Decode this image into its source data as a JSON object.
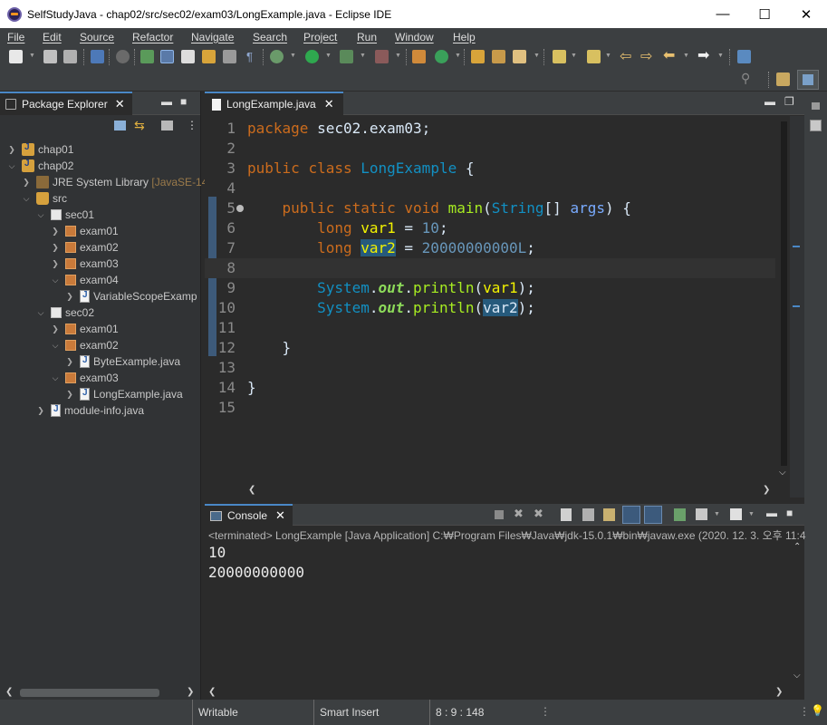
{
  "window": {
    "title": "SelfStudyJava - chap02/src/sec02/exam03/LongExample.java - Eclipse IDE",
    "minimize_glyph": "—",
    "maximize_glyph": "☐",
    "close_glyph": "✕"
  },
  "menu": [
    "File",
    "Edit",
    "Source",
    "Refactor",
    "Navigate",
    "Search",
    "Project",
    "Run",
    "Window",
    "Help"
  ],
  "package_explorer": {
    "tab_label": "Package Explorer",
    "tree": [
      {
        "label": "chap01",
        "icon": "project-icon",
        "expanded": false
      },
      {
        "label": "chap02",
        "icon": "project-icon",
        "expanded": true
      },
      {
        "label": "JRE System Library",
        "suffix": "[JavaSE-14",
        "icon": "library-icon",
        "expanded": false
      },
      {
        "label": "src",
        "icon": "source-folder-icon",
        "expanded": true
      },
      {
        "label": "sec01",
        "icon": "package-icon",
        "expanded": true
      },
      {
        "label": "exam01",
        "icon": "package-icon",
        "expanded": false
      },
      {
        "label": "exam02",
        "icon": "package-icon",
        "expanded": false
      },
      {
        "label": "exam03",
        "icon": "package-icon",
        "expanded": false
      },
      {
        "label": "exam04",
        "icon": "package-icon",
        "expanded": true
      },
      {
        "label": "VariableScopeExamp",
        "icon": "java-file-icon",
        "expanded": false
      },
      {
        "label": "sec02",
        "icon": "package-icon",
        "expanded": true
      },
      {
        "label": "exam01",
        "icon": "package-icon",
        "expanded": false
      },
      {
        "label": "exam02",
        "icon": "package-icon",
        "expanded": true
      },
      {
        "label": "ByteExample.java",
        "icon": "java-file-icon",
        "expanded": false
      },
      {
        "label": "exam03",
        "icon": "package-icon",
        "expanded": true
      },
      {
        "label": "LongExample.java",
        "icon": "java-file-icon",
        "expanded": false
      },
      {
        "label": "module-info.java",
        "icon": "java-file-icon",
        "expanded": false
      }
    ]
  },
  "editor": {
    "tab_label": "LongExample.java",
    "current_line": 8,
    "lines": [
      {
        "n": "1",
        "tokens": [
          [
            "kw",
            "package"
          ],
          [
            "p",
            " sec02.exam03;"
          ]
        ]
      },
      {
        "n": "2",
        "tokens": []
      },
      {
        "n": "3",
        "tokens": [
          [
            "kw",
            "public"
          ],
          [
            "p",
            " "
          ],
          [
            "kw",
            "class"
          ],
          [
            "p",
            " "
          ],
          [
            "tp",
            "LongExample"
          ],
          [
            "p",
            " {"
          ]
        ]
      },
      {
        "n": "4",
        "tokens": []
      },
      {
        "n": "5",
        "tokens": [
          [
            "p",
            "    "
          ],
          [
            "kw",
            "public"
          ],
          [
            "p",
            " "
          ],
          [
            "kw",
            "static"
          ],
          [
            "p",
            " "
          ],
          [
            "kw",
            "void"
          ],
          [
            "p",
            " "
          ],
          [
            "mt",
            "main"
          ],
          [
            "p",
            "("
          ],
          [
            "tp",
            "String"
          ],
          [
            "p",
            "[] "
          ],
          [
            "vr",
            "args"
          ],
          [
            "p",
            ") {"
          ]
        ]
      },
      {
        "n": "6",
        "tokens": [
          [
            "p",
            "        "
          ],
          [
            "kw",
            "long"
          ],
          [
            "p",
            " "
          ],
          [
            "lv",
            "var1"
          ],
          [
            "p",
            " = "
          ],
          [
            "nm",
            "10"
          ],
          [
            "p",
            ";"
          ]
        ]
      },
      {
        "n": "7",
        "tokens": [
          [
            "p",
            "        "
          ],
          [
            "kw",
            "long"
          ],
          [
            "p",
            " "
          ],
          [
            "hly",
            "var2"
          ],
          [
            "p",
            " = "
          ],
          [
            "nm",
            "20000000000L"
          ],
          [
            "p",
            ";"
          ]
        ]
      },
      {
        "n": "8",
        "tokens": []
      },
      {
        "n": "9",
        "tokens": [
          [
            "p",
            "        "
          ],
          [
            "tp",
            "System"
          ],
          [
            "p",
            "."
          ],
          [
            "fd",
            "out"
          ],
          [
            "p",
            "."
          ],
          [
            "mt",
            "println"
          ],
          [
            "p",
            "("
          ],
          [
            "lv",
            "var1"
          ],
          [
            "p",
            ");"
          ]
        ]
      },
      {
        "n": "10",
        "tokens": [
          [
            "p",
            "        "
          ],
          [
            "tp",
            "System"
          ],
          [
            "p",
            "."
          ],
          [
            "fd",
            "out"
          ],
          [
            "p",
            "."
          ],
          [
            "mt",
            "println"
          ],
          [
            "p",
            "("
          ],
          [
            "hl",
            "var2"
          ],
          [
            "p",
            ");"
          ]
        ]
      },
      {
        "n": "11",
        "tokens": []
      },
      {
        "n": "12",
        "tokens": [
          [
            "p",
            "    }"
          ]
        ]
      },
      {
        "n": "13",
        "tokens": []
      },
      {
        "n": "14",
        "tokens": [
          [
            "p",
            "}"
          ]
        ]
      },
      {
        "n": "15",
        "tokens": []
      }
    ]
  },
  "console": {
    "tab_label": "Console",
    "status": "<terminated> LongExample [Java Application] C:₩Program Files₩Java₩jdk-15.0.1₩bin₩javaw.exe  (2020. 12. 3. 오후 11:4",
    "output": [
      "10",
      "20000000000"
    ]
  },
  "statusbar": {
    "writable": "Writable",
    "insert_mode": "Smart Insert",
    "position": "8 : 9 : 148"
  },
  "colors": {
    "keyword": "#cc6c1d",
    "type": "#1290c3",
    "accent": "#4a88c7"
  }
}
